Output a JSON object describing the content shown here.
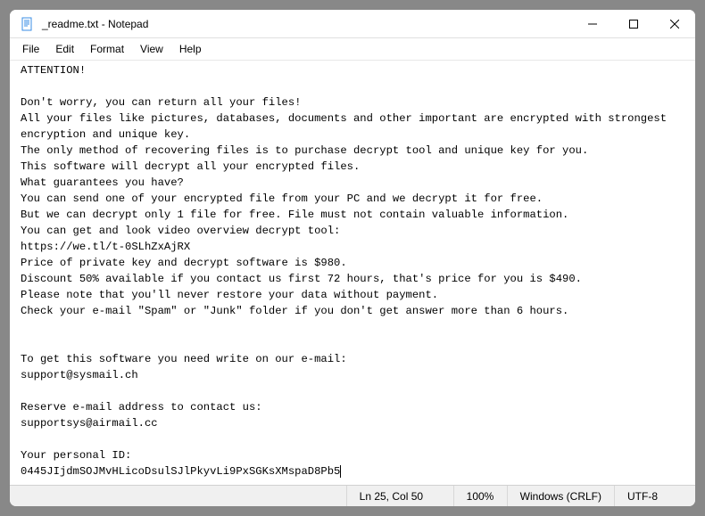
{
  "titlebar": {
    "title": "_readme.txt - Notepad"
  },
  "menu": {
    "file": "File",
    "edit": "Edit",
    "format": "Format",
    "view": "View",
    "help": "Help"
  },
  "document": {
    "lines": [
      "ATTENTION!",
      "",
      "Don't worry, you can return all your files!",
      "All your files like pictures, databases, documents and other important are encrypted with strongest encryption and unique key.",
      "The only method of recovering files is to purchase decrypt tool and unique key for you.",
      "This software will decrypt all your encrypted files.",
      "What guarantees you have?",
      "You can send one of your encrypted file from your PC and we decrypt it for free.",
      "But we can decrypt only 1 file for free. File must not contain valuable information.",
      "You can get and look video overview decrypt tool:",
      "https://we.tl/t-0SLhZxAjRX",
      "Price of private key and decrypt software is $980.",
      "Discount 50% available if you contact us first 72 hours, that's price for you is $490.",
      "Please note that you'll never restore your data without payment.",
      "Check your e-mail \"Spam\" or \"Junk\" folder if you don't get answer more than 6 hours.",
      "",
      "",
      "To get this software you need write on our e-mail:",
      "support@sysmail.ch",
      "",
      "Reserve e-mail address to contact us:",
      "supportsys@airmail.cc",
      "",
      "Your personal ID:",
      "0445JIjdmSOJMvHLicoDsulSJlPkyvLi9PxSGKsXMspaD8Pb5"
    ]
  },
  "statusbar": {
    "position": "Ln 25, Col 50",
    "zoom": "100%",
    "line_ending": "Windows (CRLF)",
    "encoding": "UTF-8"
  }
}
